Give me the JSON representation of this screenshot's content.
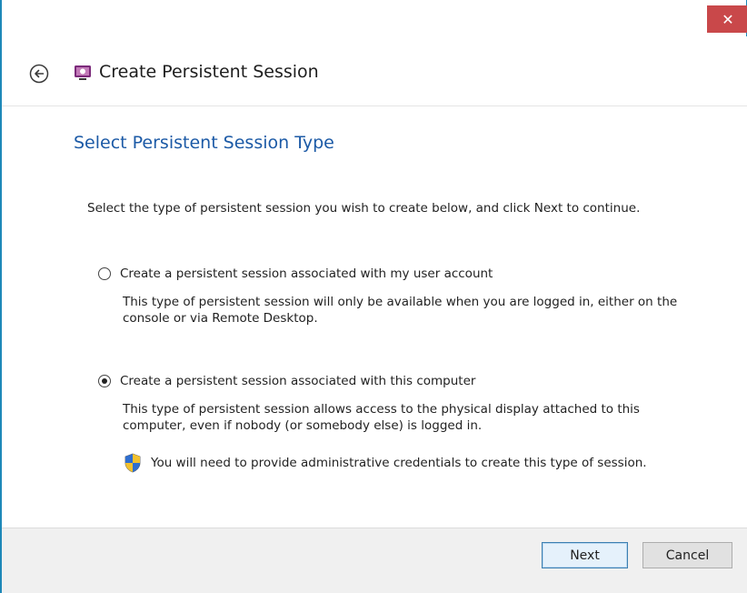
{
  "window": {
    "close_glyph": "✕"
  },
  "header": {
    "title": "Create Persistent Session",
    "back_icon": "back-arrow-icon",
    "app_icon": "remote-session-icon"
  },
  "page": {
    "section_title": "Select Persistent Session Type",
    "intro": "Select the type of persistent session you wish to create below, and click Next to continue.",
    "options": [
      {
        "label": "Create a persistent session associated with my user account",
        "description": "This type of persistent session will only be available when you are logged in, either on the console or via Remote Desktop.",
        "selected": false
      },
      {
        "label": "Create a persistent session associated with this computer",
        "description": "This type of persistent session allows access to the physical display attached to this computer, even if nobody (or somebody else) is logged in.",
        "selected": true
      }
    ],
    "note": "You will need to provide administrative credentials to create this type of session.",
    "note_icon": "uac-shield-icon"
  },
  "footer": {
    "next_label": "Next",
    "cancel_label": "Cancel"
  },
  "colors": {
    "accent": "#1e88b8",
    "close": "#c9484a",
    "heading": "#1c5aa6"
  }
}
